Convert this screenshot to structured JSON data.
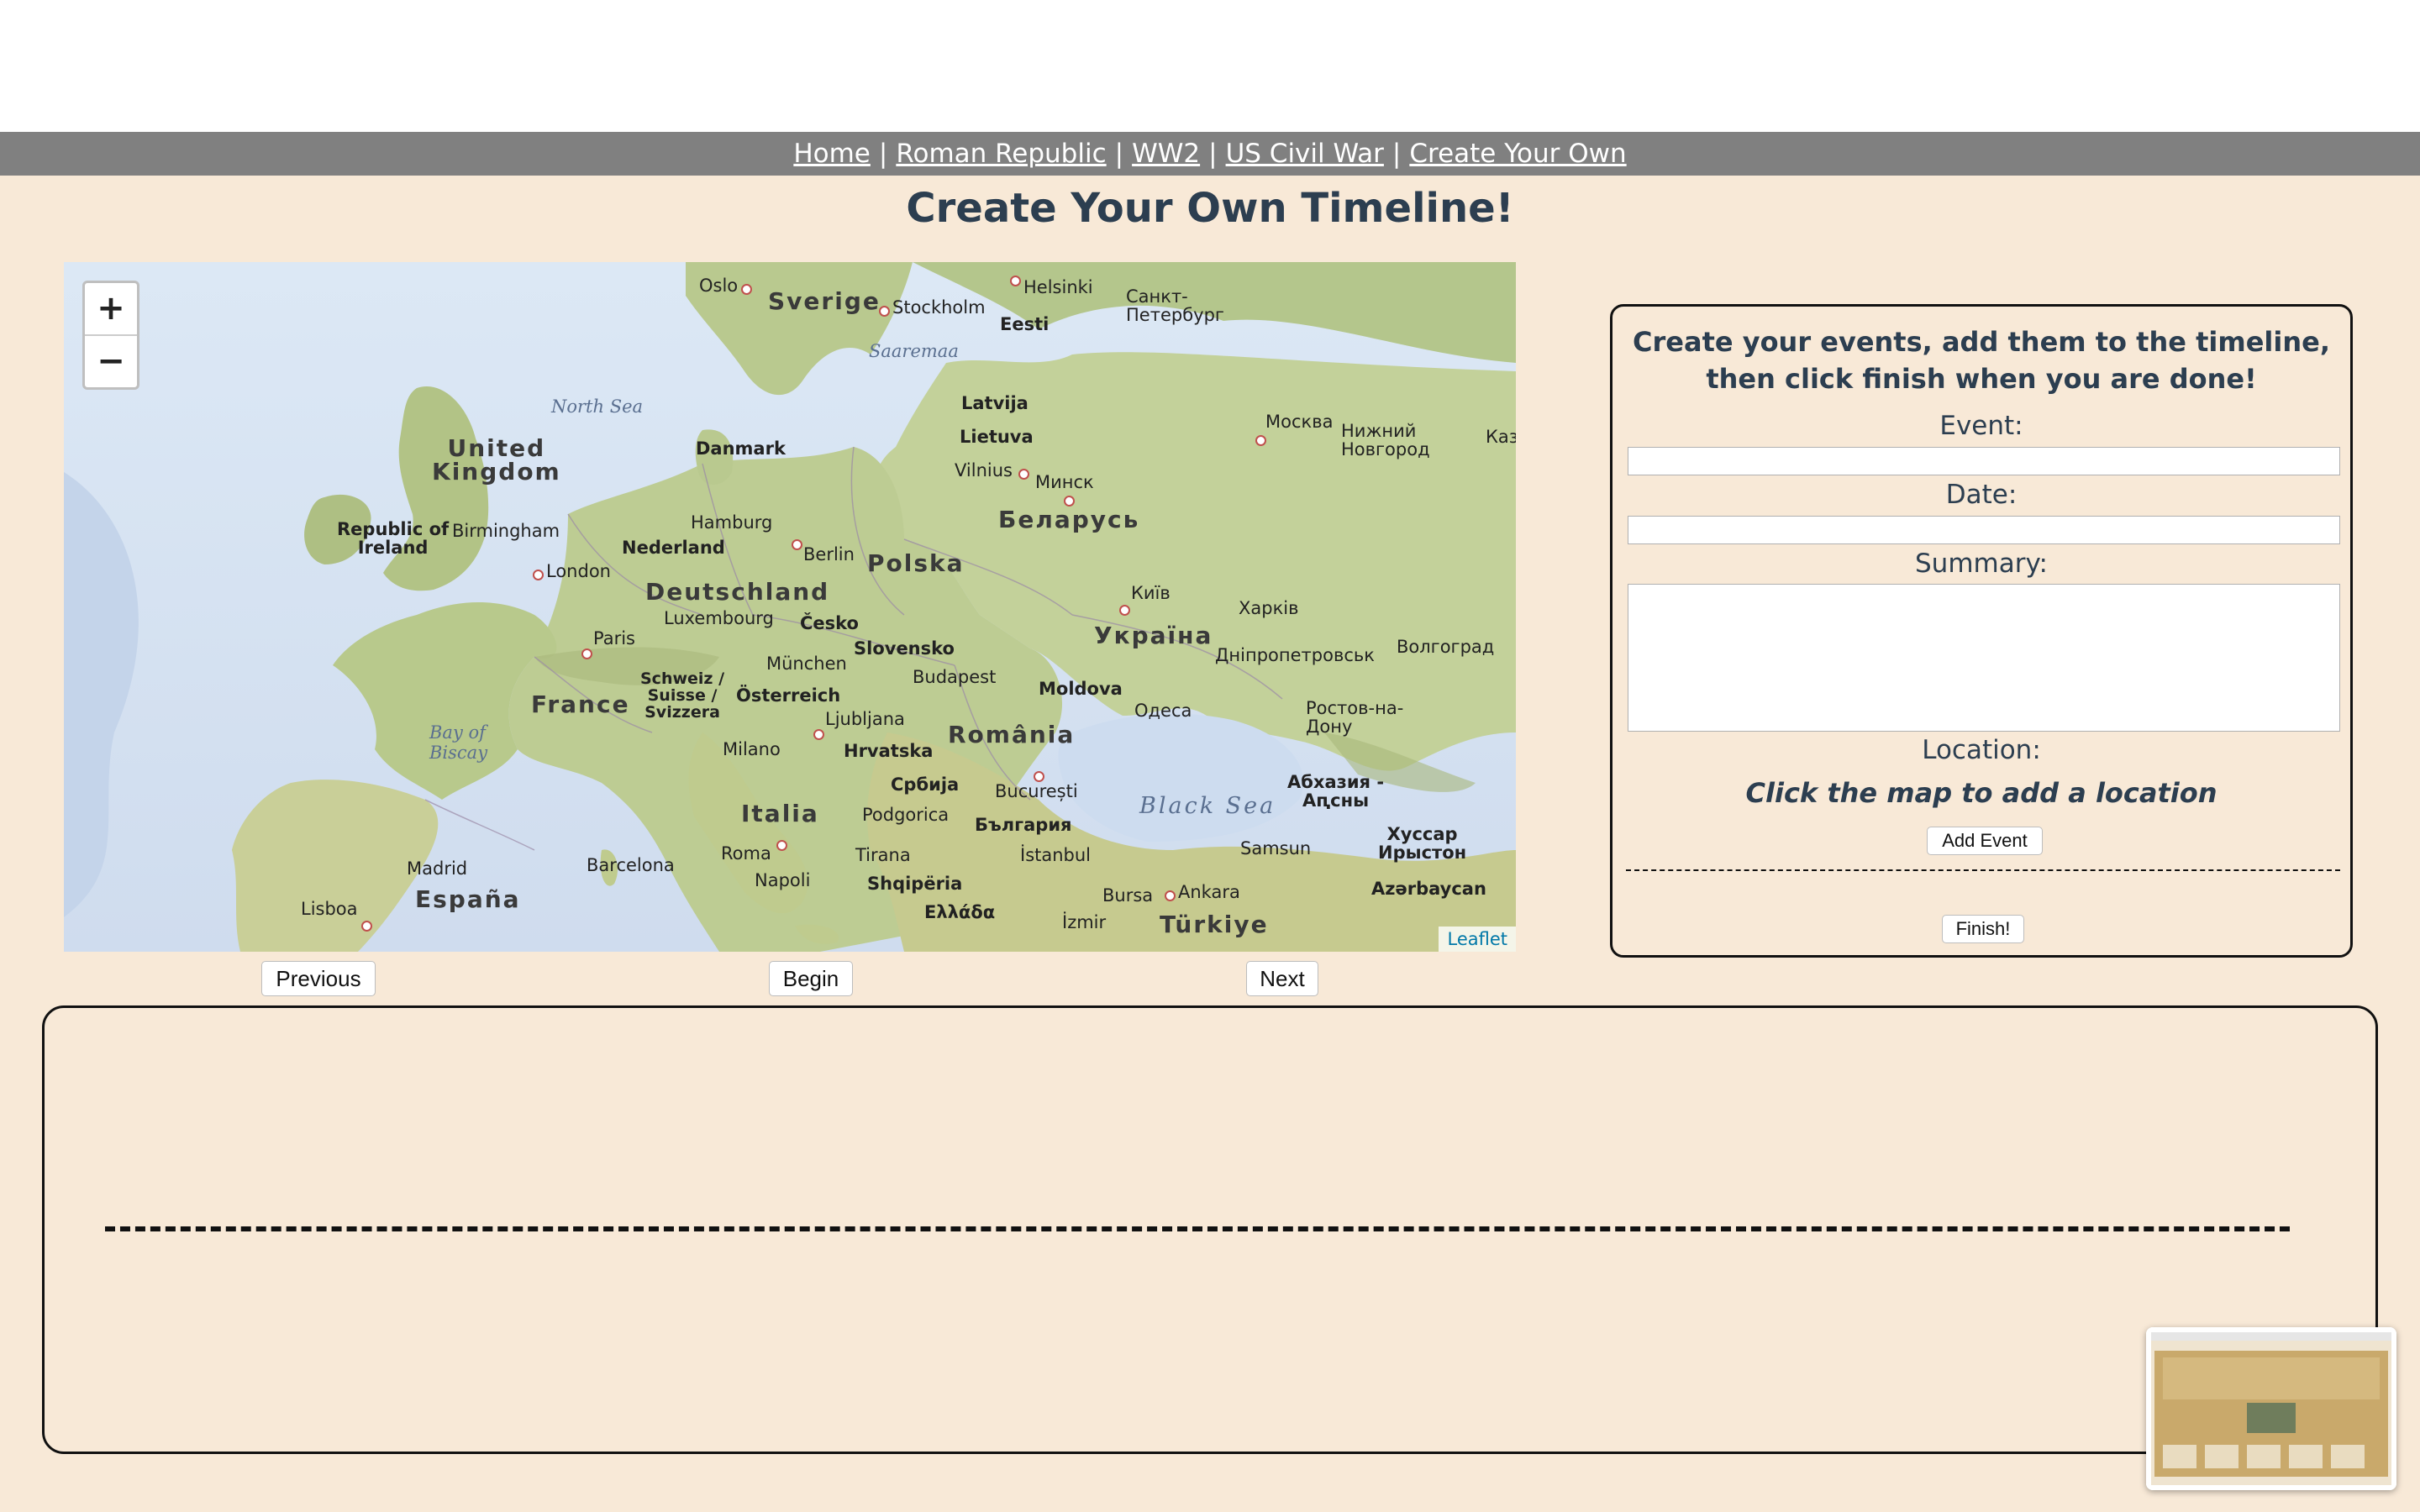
{
  "nav": {
    "links": [
      "Home",
      "Roman Republic",
      "WW2",
      "US Civil War",
      "Create Your Own"
    ],
    "separator": "|"
  },
  "page_title": "Create Your Own Timeline!",
  "map": {
    "zoom_in": "+",
    "zoom_out": "−",
    "attribution": "Leaflet",
    "labels": {
      "united_kingdom_1": "United",
      "united_kingdom_2": "Kingdom",
      "ireland_1": "Republic of",
      "ireland_2": "Ireland",
      "north_sea": "North Sea",
      "bay_biscay_1": "Bay of",
      "bay_biscay_2": "Biscay",
      "france": "France",
      "espana": "España",
      "deutschland": "Deutschland",
      "polska": "Polska",
      "italia": "Italia",
      "romania": "România",
      "ukraina": "Україна",
      "belarus": "Беларусь",
      "sverige": "Sverige",
      "turkiye": "Türkiye",
      "black_sea": "Black Sea",
      "nederland": "Nederland",
      "danmark": "Danmark",
      "cesko": "Česko",
      "slovensko": "Slovensko",
      "osterreich": "Österreich",
      "schweiz_1": "Schweiz /",
      "schweiz_2": "Suisse /",
      "schweiz_3": "Svizzera",
      "hrvatska": "Hrvatska",
      "srbija": "Србија",
      "bulgaria": "България",
      "moldova": "Moldova",
      "latvija": "Latvija",
      "lietuva": "Lietuva",
      "eesti": "Eesti",
      "shqiperia": "Shqipëria",
      "ellada": "Ελλάδα",
      "azerbaycan": "Azərbaycan",
      "abkhazia_1": "Абхазия -",
      "abkhazia_2": "Аԥсны",
      "hussar_1": "Хуссар",
      "hussar_2": "Ирыстон",
      "saaremaa": "Saaremaa",
      "london": "London",
      "paris": "Paris",
      "berlin": "Berlin",
      "hamburg": "Hamburg",
      "birmingham": "Birmingham",
      "luxembourg": "Luxembourg",
      "munchen": "München",
      "milano": "Milano",
      "roma": "Roma",
      "napoli": "Napoli",
      "madrid": "Madrid",
      "barcelona": "Barcelona",
      "lisboa": "Lisboa",
      "oslo": "Oslo",
      "stockholm": "Stockholm",
      "helsinki": "Helsinki",
      "spb_1": "Санкт-",
      "spb_2": "Петербург",
      "moskva": "Москва",
      "nn_1": "Нижний",
      "nn_2": "Новгород",
      "vilnius": "Vilnius",
      "minsk": "Минск",
      "kyiv": "Київ",
      "kharkiv": "Харків",
      "dnipro": "Дніпропетровськ",
      "volgograd": "Волгоград",
      "rostov_1": "Ростов-на-",
      "rostov_2": "Дону",
      "odesa": "Одеса",
      "budapest": "Budapest",
      "ljubljana": "Ljubljana",
      "bucuresti": "București",
      "podgorica": "Podgorica",
      "tirana": "Tirana",
      "istanbul": "İstanbul",
      "bursa": "Bursa",
      "ankara": "Ankara",
      "izmir": "İzmir",
      "samsun": "Samsun",
      "kaz": "Каз"
    }
  },
  "buttons": {
    "previous": "Previous",
    "begin": "Begin",
    "next": "Next",
    "add_event": "Add Event",
    "finish": "Finish!"
  },
  "form": {
    "instructions": "Create your events, add them to the timeline, then click finish when you are done!",
    "event_label": "Event:",
    "date_label": "Date:",
    "summary_label": "Summary:",
    "location_label": "Location:",
    "location_hint": "Click the map to add a location",
    "event_value": "",
    "date_value": "",
    "summary_value": ""
  },
  "colors": {
    "background": "#f8e9d7",
    "navbar": "#808080",
    "title_text": "#2c3e50"
  }
}
